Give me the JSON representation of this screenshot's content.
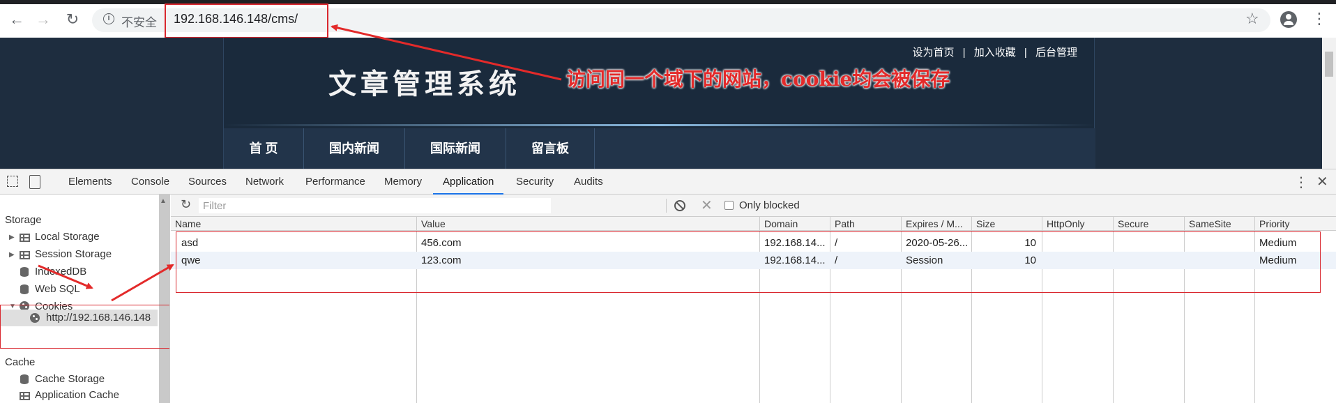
{
  "browser": {
    "security_label": "不安全",
    "url": "192.168.146.148/cms/",
    "icons": {
      "back": "back-arrow-icon",
      "forward": "forward-arrow-icon",
      "reload": "reload-icon",
      "info": "info-icon",
      "star": "star-icon",
      "account": "account-icon",
      "menu": "kebab-menu-icon"
    }
  },
  "site": {
    "top_links": [
      "设为首页",
      "加入收藏",
      "后台管理"
    ],
    "separator": "|",
    "title": "文章管理系统",
    "nav": [
      "首 页",
      "国内新闻",
      "国际新闻",
      "留言板"
    ]
  },
  "annotation": {
    "text": "访问同一个域下的网站，cookie均会被保存",
    "color": "#e32a2a"
  },
  "devtools": {
    "tabs": [
      "Elements",
      "Console",
      "Sources",
      "Network",
      "Performance",
      "Memory",
      "Application",
      "Security",
      "Audits"
    ],
    "active_tab": "Application",
    "sidebar": {
      "storage_heading": "Storage",
      "storage_items": [
        "Local Storage",
        "Session Storage",
        "IndexedDB",
        "Web SQL",
        "Cookies"
      ],
      "cookie_origin": "http://192.168.146.148",
      "cache_heading": "Cache",
      "cache_items": [
        "Cache Storage",
        "Application Cache"
      ]
    },
    "toolbar": {
      "filter_placeholder": "Filter",
      "only_blocked_label": "Only blocked"
    },
    "cookie_table": {
      "columns": [
        "Name",
        "Value",
        "Domain",
        "Path",
        "Expires / M...",
        "Size",
        "HttpOnly",
        "Secure",
        "SameSite",
        "Priority"
      ],
      "rows": [
        {
          "name": "asd",
          "value": "456.com",
          "domain": "192.168.14...",
          "path": "/",
          "expires": "2020-05-26...",
          "size": "10",
          "httponly": "",
          "secure": "",
          "samesite": "",
          "priority": "Medium"
        },
        {
          "name": "qwe",
          "value": "123.com",
          "domain": "192.168.14...",
          "path": "/",
          "expires": "Session",
          "size": "10",
          "httponly": "",
          "secure": "",
          "samesite": "",
          "priority": "Medium"
        }
      ]
    },
    "accent_color": "#1a73e8"
  }
}
